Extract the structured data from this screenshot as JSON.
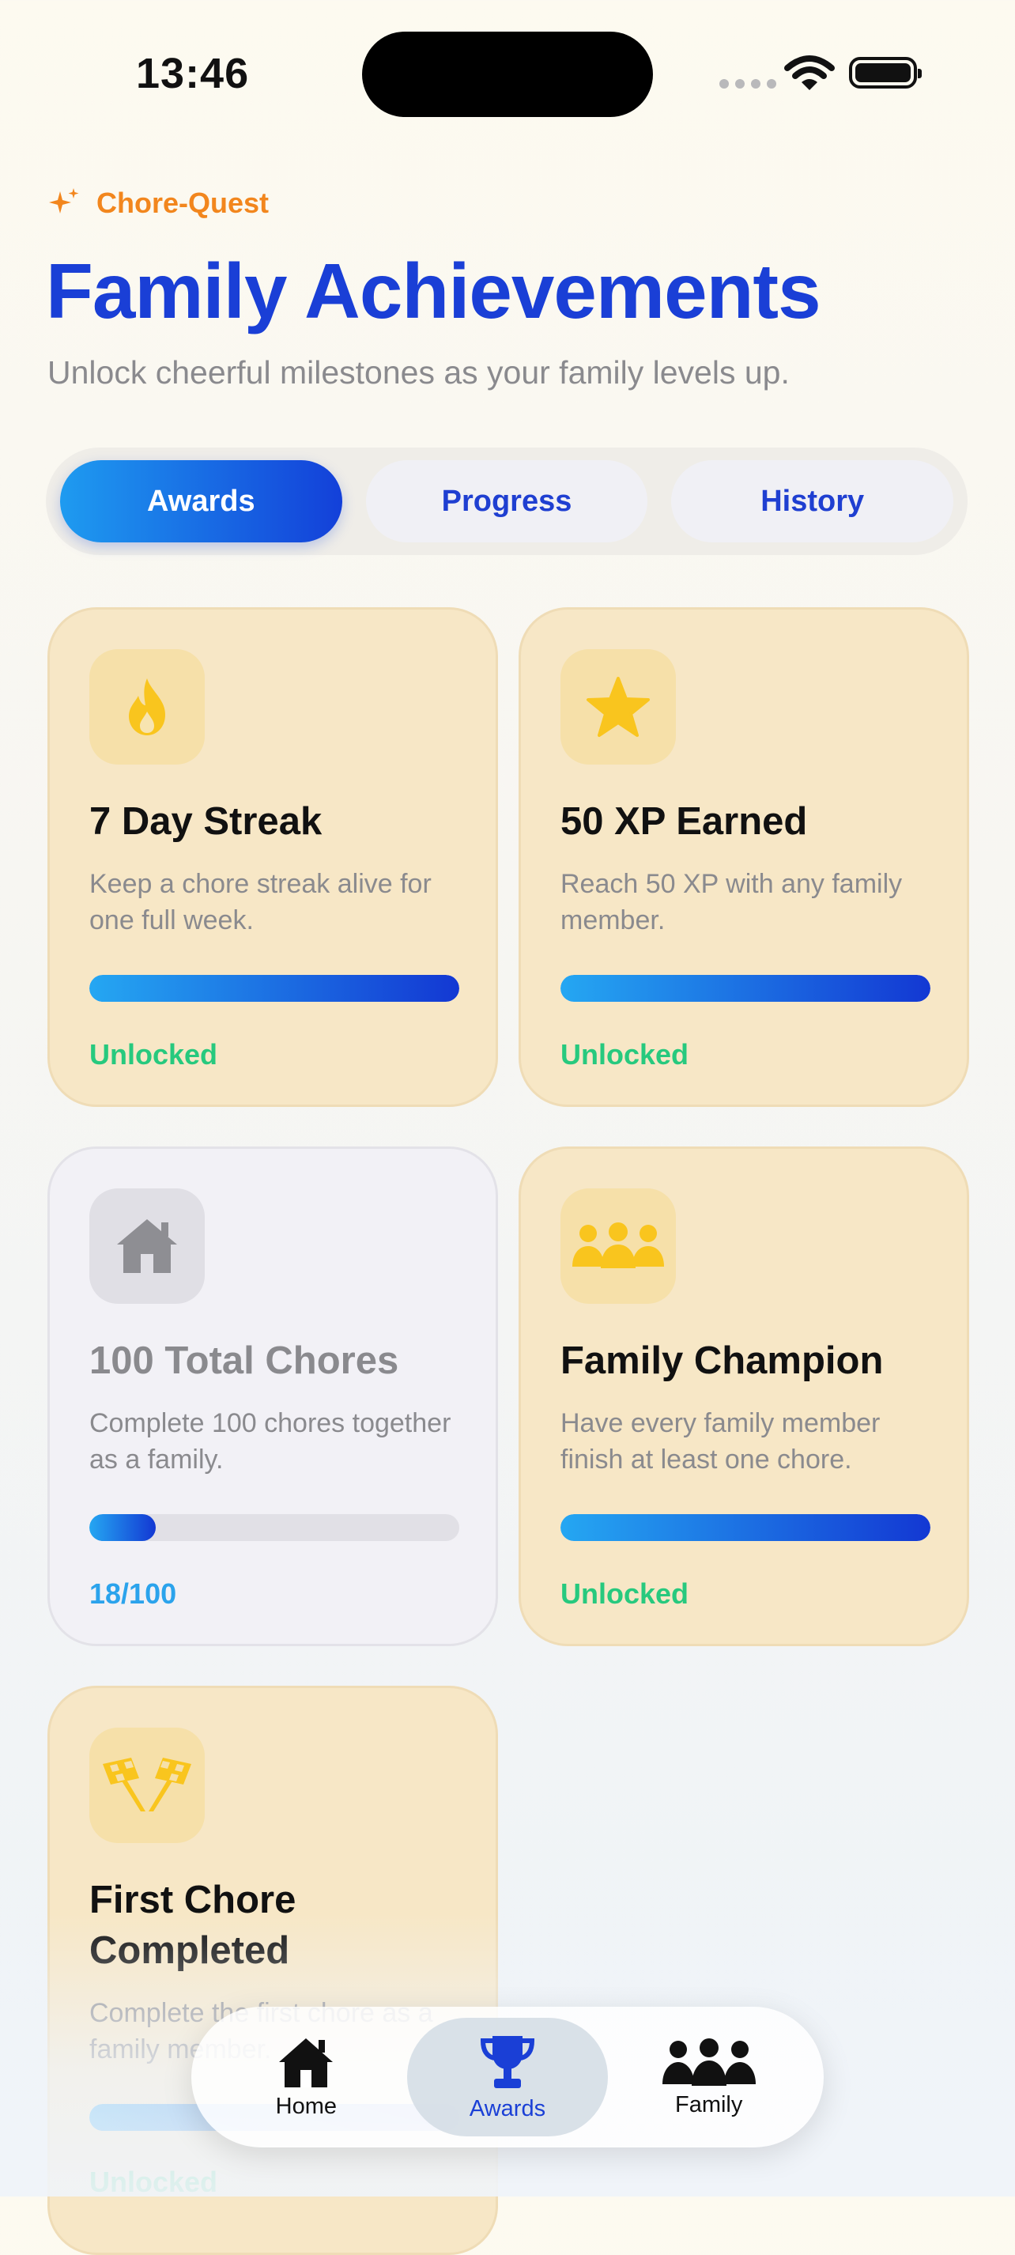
{
  "status_bar": {
    "time": "13:46"
  },
  "header": {
    "brand": "Chore-Quest",
    "title": "Family Achievements",
    "subtitle": "Unlock cheerful milestones as your family levels up."
  },
  "segments": [
    {
      "label": "Awards",
      "selected": true
    },
    {
      "label": "Progress",
      "selected": false
    },
    {
      "label": "History",
      "selected": false
    }
  ],
  "achievements": [
    {
      "icon": "flame-icon",
      "title": "7 Day Streak",
      "description": "Keep a chore streak alive for one full week.",
      "progress": 1.0,
      "status": "Unlocked",
      "unlocked": true
    },
    {
      "icon": "star-icon",
      "title": "50 XP Earned",
      "description": "Reach 50 XP with any family member.",
      "progress": 1.0,
      "status": "Unlocked",
      "unlocked": true
    },
    {
      "icon": "house-icon",
      "title": "100 Total Chores",
      "description": "Complete 100 chores together as a family.",
      "progress": 0.18,
      "status": "18/100",
      "unlocked": false
    },
    {
      "icon": "people-icon",
      "title": "Family Champion",
      "description": "Have every family member finish at least one chore.",
      "progress": 1.0,
      "status": "Unlocked",
      "unlocked": true
    },
    {
      "icon": "checkered-flags-icon",
      "title": "First Chore Completed",
      "description": "Complete the first chore as a family member.",
      "progress": 1.0,
      "status": "Unlocked",
      "unlocked": true
    }
  ],
  "tab_bar": [
    {
      "label": "Home",
      "icon": "house-icon",
      "selected": false
    },
    {
      "label": "Awards",
      "icon": "trophy-icon",
      "selected": true
    },
    {
      "label": "Family",
      "icon": "people-icon",
      "selected": false
    }
  ],
  "colors": {
    "accent": "#1a3fd6",
    "brand": "#f2861d",
    "success": "#27c97e",
    "progress": "#2ba3ec",
    "icon_gold": "#f9c51e"
  }
}
